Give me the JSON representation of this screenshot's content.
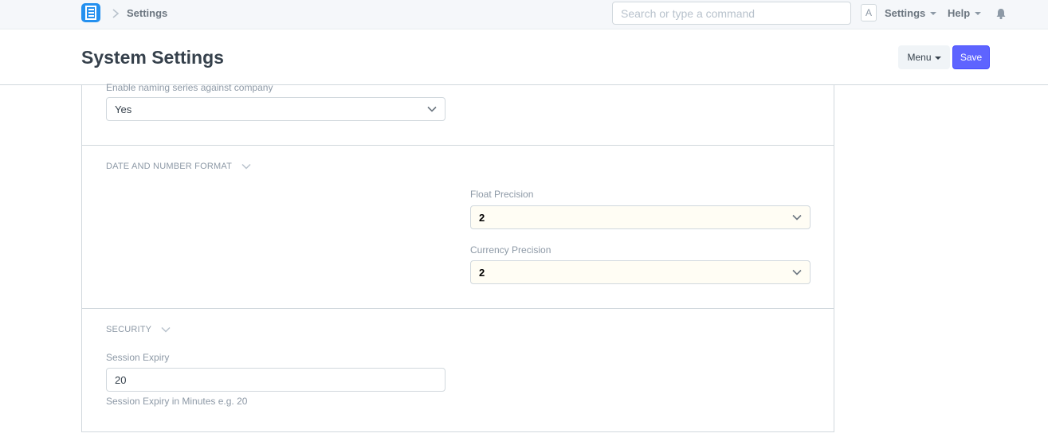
{
  "navbar": {
    "breadcrumb": "Settings",
    "search_placeholder": "Search or type a command",
    "avatar_letter": "A",
    "settings_label": "Settings",
    "help_label": "Help"
  },
  "page": {
    "title": "System Settings",
    "menu_label": "Menu",
    "save_label": "Save"
  },
  "form": {
    "naming_series": {
      "label": "Enable naming series against company",
      "value": "Yes"
    },
    "date_number_section": "DATE AND NUMBER FORMAT",
    "float_precision": {
      "label": "Float Precision",
      "value": "2"
    },
    "currency_precision": {
      "label": "Currency Precision",
      "value": "2"
    },
    "security_section": "SECURITY",
    "session_expiry": {
      "label": "Session Expiry",
      "value": "20",
      "description": "Session Expiry in Minutes e.g. 20"
    }
  },
  "colors": {
    "primary": "#5e64ff",
    "logo": "#2490ef",
    "highlight_field": "#fffdf4"
  },
  "icons": [
    "app-logo-icon",
    "chevron-right-icon",
    "caret-down-icon",
    "bell-icon",
    "chevron-down-icon"
  ]
}
